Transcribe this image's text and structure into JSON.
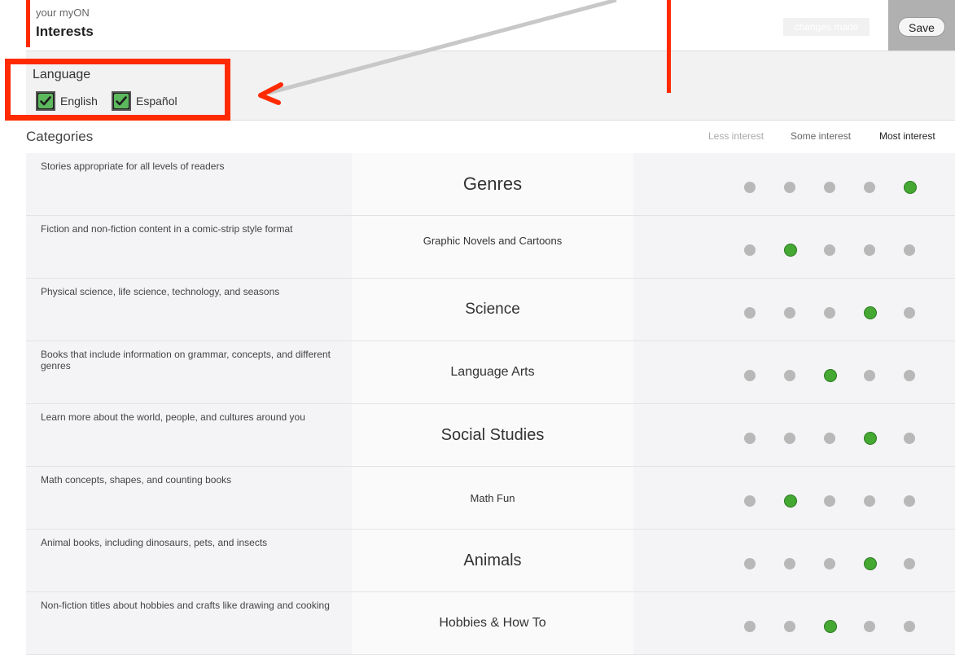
{
  "header": {
    "subtitle": "your myON",
    "title": "Interests",
    "changes_label": "changes made",
    "save_label": "Save"
  },
  "language": {
    "label": "Language",
    "options": [
      {
        "label": "English",
        "checked": true
      },
      {
        "label": "Español",
        "checked": true
      }
    ]
  },
  "categories": {
    "label": "Categories",
    "scale": [
      "Less interest",
      "Some interest",
      "Most interest"
    ],
    "items": [
      {
        "description": "Stories appropriate for all levels of readers",
        "name": "Genres",
        "interest": 5
      },
      {
        "description": "Fiction and non-fiction content in a comic-strip style format",
        "name": "Graphic Novels and Cartoons",
        "interest": 2
      },
      {
        "description": "Physical science, life science, technology, and seasons",
        "name": "Science",
        "interest": 4
      },
      {
        "description": "Books that include information on grammar, concepts, and different genres",
        "name": "Language Arts",
        "interest": 3
      },
      {
        "description": "Learn more about the world, people, and cultures around you",
        "name": "Social Studies",
        "interest": 4
      },
      {
        "description": "Math concepts, shapes, and counting books",
        "name": "Math Fun",
        "interest": 2
      },
      {
        "description": "Animal books, including dinosaurs, pets, and insects",
        "name": "Animals",
        "interest": 4
      },
      {
        "description": "Non-fiction titles about hobbies and crafts like drawing and cooking",
        "name": "Hobbies & How To",
        "interest": 3
      }
    ]
  },
  "colors": {
    "selected": "#44a833",
    "unselected": "#b8b8b8",
    "annotation": "#ff2a00"
  }
}
